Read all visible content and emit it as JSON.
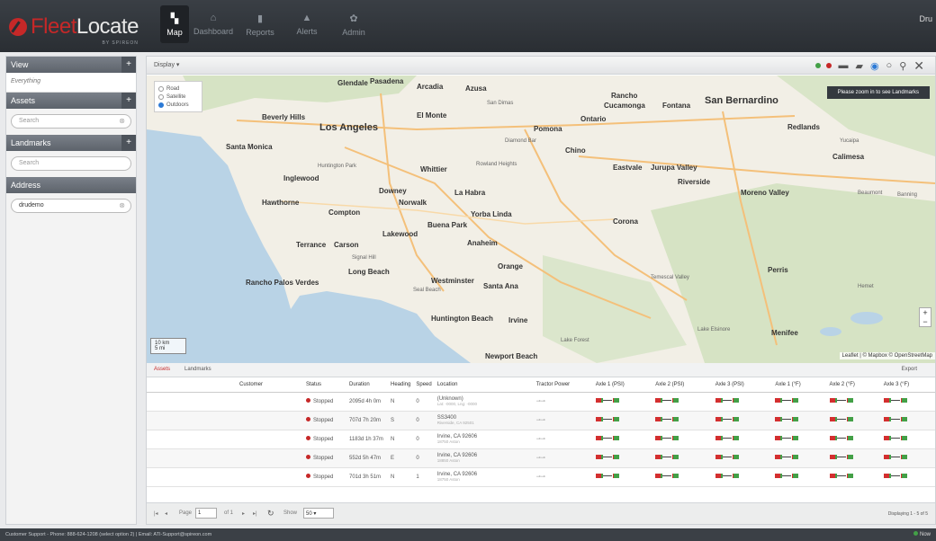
{
  "header": {
    "logo_fleet": "Fleet",
    "logo_locate": "Locate",
    "logo_sub": "BY SPIREON",
    "nav": [
      {
        "label": "Map",
        "icon": "map-icon"
      },
      {
        "label": "Dashboard",
        "icon": "home-icon"
      },
      {
        "label": "Reports",
        "icon": "bar-chart-icon"
      },
      {
        "label": "Alerts",
        "icon": "bell-icon"
      },
      {
        "label": "Admin",
        "icon": "gear-icon"
      }
    ],
    "user": "Dru"
  },
  "sidebar": {
    "view_label": "View",
    "view_value": "Everything",
    "assets_label": "Assets",
    "assets_placeholder": "Search",
    "landmarks_label": "Landmarks",
    "landmarks_placeholder": "Search",
    "address_label": "Address",
    "address_value": "drudemo"
  },
  "map_toolbar": {
    "display_label": "Display"
  },
  "map": {
    "layers": [
      "Road",
      "Satellite",
      "Outdoors"
    ],
    "selected_layer": "Outdoors",
    "zoom_message": "Please zoom in to see Landmarks",
    "scale_km": "10 km",
    "scale_mi": "5 mi",
    "attribution": "Leaflet | © Mapbox © OpenStreetMap",
    "labels": {
      "glendale": "Glendale",
      "pasadena": "Pasadena",
      "arcadia": "Arcadia",
      "azusa": "Azusa",
      "san_dimas": "San Dimas",
      "rancho": "Rancho",
      "cucamonga": "Cucamonga",
      "fontana": "Fontana",
      "san_bernardino": "San Bernardino",
      "beverly_hills": "Beverly Hills",
      "los_angeles": "Los Angeles",
      "el_monte": "El Monte",
      "ontario": "Ontario",
      "pomona": "Pomona",
      "redlands": "Redlands",
      "santa_monica": "Santa Monica",
      "diamond_bar": "Diamond Bar",
      "chino": "Chino",
      "huntington_park": "Huntington Park",
      "whittier": "Whittier",
      "rowland_heights": "Rowland Heights",
      "eastvale": "Eastvale",
      "jurupa_valley": "Jurupa Valley",
      "yucaipa": "Yucaipa",
      "calimesa": "Calimesa",
      "inglewood": "Inglewood",
      "downey": "Downey",
      "riverside": "Riverside",
      "moreno_valley": "Moreno Valley",
      "beaumont": "Beaumont",
      "banning": "Banning",
      "hawthorne": "Hawthorne",
      "norwalk": "Norwalk",
      "la_habra": "La Habra",
      "compton": "Compton",
      "yorba_linda": "Yorba Linda",
      "buena_park": "Buena Park",
      "corona": "Corona",
      "lakewood": "Lakewood",
      "torrance": "Terrance",
      "carson": "Carson",
      "anaheim": "Anaheim",
      "signal_hill": "Signal Hill",
      "long_beach": "Long Beach",
      "orange": "Orange",
      "perris": "Perris",
      "rancho_palos_verdes": "Rancho Palos Verdes",
      "seal_beach": "Seal Beach",
      "westminster": "Westminster",
      "santa_ana": "Santa Ana",
      "temescal_valley": "Temescal Valley",
      "hemet": "Hemet",
      "huntington_beach": "Huntington Beach",
      "irvine": "Irvine",
      "menifee": "Menifee",
      "lake_elsinore": "Lake Elsinore",
      "lake_forest": "Lake Forest",
      "newport_beach": "Newport Beach"
    }
  },
  "grid": {
    "tabs": [
      "Assets",
      "Landmarks"
    ],
    "export": "Export",
    "columns": [
      "Customer",
      "Status",
      "Duration",
      "Heading",
      "Speed",
      "Location",
      "Tractor Power",
      "Axle 1 (PSI)",
      "Axle 2 (PSI)",
      "Axle 3 (PSI)",
      "Axle 1 (°F)",
      "Axle 2 (°F)",
      "Axle 3 (°F)"
    ],
    "rows": [
      {
        "status": "Stopped",
        "duration": "2095d 4h 0m",
        "heading": "N",
        "speed": "0",
        "location": "(Unknown)",
        "location_sub": "Lat: -0000, Lng: -0000"
      },
      {
        "status": "Stopped",
        "duration": "707d 7h 20m",
        "heading": "S",
        "speed": "0",
        "location": "SS3400",
        "location_sub": "Riverside, CA 92501"
      },
      {
        "status": "Stopped",
        "duration": "1183d 1h 37m",
        "heading": "N",
        "speed": "0",
        "location": "Irvine, CA 92606",
        "location_sub": "18750 Aston"
      },
      {
        "status": "Stopped",
        "duration": "552d 5h 47m",
        "heading": "E",
        "speed": "0",
        "location": "Irvine, CA 92606",
        "location_sub": "18850 Aston"
      },
      {
        "status": "Stopped",
        "duration": "701d 3h 51m",
        "heading": "N",
        "speed": "1",
        "location": "Irvine, CA 92606",
        "location_sub": "18750 Aston"
      }
    ]
  },
  "pager": {
    "page_label": "Page",
    "page_value": "1",
    "of_label": "of 1",
    "show_label": "Show",
    "show_value": "50",
    "displaying": "Displaying 1 - 5 of 5"
  },
  "footer": {
    "support": "Customer Support - Phone: 888-624-1208 (select option 2) | Email: ATI-Support@spireon.com",
    "status": "Now"
  },
  "colors": {
    "brand_red": "#c62828",
    "topbar": "#2a2e33",
    "ocean": "#b9d3e6",
    "land": "#f2efe6",
    "hills": "#d6e3c4",
    "highway": "#f4c07a"
  }
}
